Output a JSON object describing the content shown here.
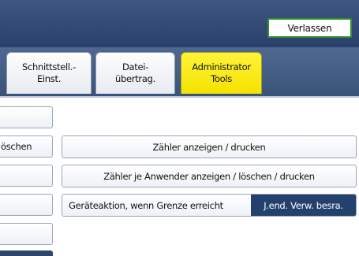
{
  "header": {
    "exit_label": "Verlassen"
  },
  "tabs": [
    {
      "line1": "Schnittstell.-",
      "line2": "Einst."
    },
    {
      "line1": "Datei-",
      "line2": "übertrag."
    },
    {
      "line1": "Administrator",
      "line2": "Tools",
      "active": true
    }
  ],
  "left_column": {
    "items": [
      "",
      "öschen",
      "",
      "",
      "",
      ""
    ]
  },
  "main_buttons": [
    {
      "label": "Zähler anzeigen / drucken"
    },
    {
      "label": "Zähler je Anwender anzeigen / löschen / drucken"
    },
    {
      "label": "Geräteaktion, wenn Grenze erreicht",
      "value": "J.end. Verw. besra."
    }
  ],
  "colors": {
    "header": "#2f4872",
    "active_tab": "#f7e51a",
    "exit_border": "#2f8f2f",
    "value_bg": "#23406e"
  }
}
